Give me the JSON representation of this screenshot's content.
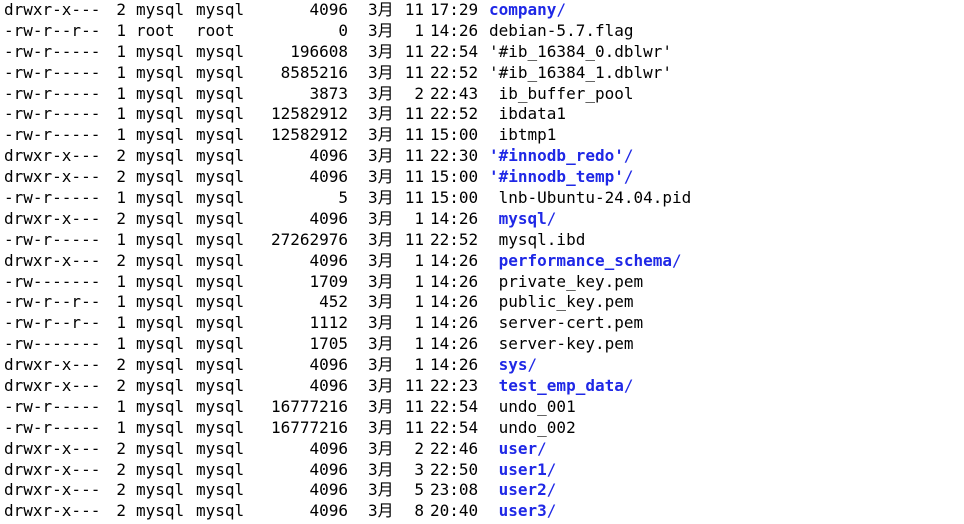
{
  "colors": {
    "background": "#ffffff",
    "text": "#000000",
    "directory": "#1f28e6"
  },
  "listing": [
    {
      "perms": "drwxr-x---",
      "links": "2",
      "owner": "mysql",
      "group": "mysql",
      "size": "4096",
      "month": "3月",
      "day": "11",
      "time": "17:29",
      "name": "company",
      "suffix": "/",
      "is_dir": true
    },
    {
      "perms": "-rw-r--r--",
      "links": "1",
      "owner": "root",
      "group": "root",
      "size": "0",
      "month": "3月",
      "day": "1",
      "time": "14:26",
      "name": "debian-5.7.flag",
      "suffix": "",
      "is_dir": false
    },
    {
      "perms": "-rw-r-----",
      "links": "1",
      "owner": "mysql",
      "group": "mysql",
      "size": "196608",
      "month": "3月",
      "day": "11",
      "time": "22:54",
      "name": "'#ib_16384_0.dblwr'",
      "suffix": "",
      "is_dir": false
    },
    {
      "perms": "-rw-r-----",
      "links": "1",
      "owner": "mysql",
      "group": "mysql",
      "size": "8585216",
      "month": "3月",
      "day": "11",
      "time": "22:52",
      "name": "'#ib_16384_1.dblwr'",
      "suffix": "",
      "is_dir": false
    },
    {
      "perms": "-rw-r-----",
      "links": "1",
      "owner": "mysql",
      "group": "mysql",
      "size": "3873",
      "month": "3月",
      "day": "2",
      "time": "22:43",
      "name": " ib_buffer_pool",
      "suffix": "",
      "is_dir": false
    },
    {
      "perms": "-rw-r-----",
      "links": "1",
      "owner": "mysql",
      "group": "mysql",
      "size": "12582912",
      "month": "3月",
      "day": "11",
      "time": "22:52",
      "name": " ibdata1",
      "suffix": "",
      "is_dir": false
    },
    {
      "perms": "-rw-r-----",
      "links": "1",
      "owner": "mysql",
      "group": "mysql",
      "size": "12582912",
      "month": "3月",
      "day": "11",
      "time": "15:00",
      "name": " ibtmp1",
      "suffix": "",
      "is_dir": false
    },
    {
      "perms": "drwxr-x---",
      "links": "2",
      "owner": "mysql",
      "group": "mysql",
      "size": "4096",
      "month": "3月",
      "day": "11",
      "time": "22:30",
      "name": "'#innodb_redo'",
      "suffix": "/",
      "is_dir": true
    },
    {
      "perms": "drwxr-x---",
      "links": "2",
      "owner": "mysql",
      "group": "mysql",
      "size": "4096",
      "month": "3月",
      "day": "11",
      "time": "15:00",
      "name": "'#innodb_temp'",
      "suffix": "/",
      "is_dir": true
    },
    {
      "perms": "-rw-r-----",
      "links": "1",
      "owner": "mysql",
      "group": "mysql",
      "size": "5",
      "month": "3月",
      "day": "11",
      "time": "15:00",
      "name": " lnb-Ubuntu-24.04.pid",
      "suffix": "",
      "is_dir": false
    },
    {
      "perms": "drwxr-x---",
      "links": "2",
      "owner": "mysql",
      "group": "mysql",
      "size": "4096",
      "month": "3月",
      "day": "1",
      "time": "14:26",
      "name": " mysql",
      "suffix": "/",
      "is_dir": true
    },
    {
      "perms": "-rw-r-----",
      "links": "1",
      "owner": "mysql",
      "group": "mysql",
      "size": "27262976",
      "month": "3月",
      "day": "11",
      "time": "22:52",
      "name": " mysql.ibd",
      "suffix": "",
      "is_dir": false
    },
    {
      "perms": "drwxr-x---",
      "links": "2",
      "owner": "mysql",
      "group": "mysql",
      "size": "4096",
      "month": "3月",
      "day": "1",
      "time": "14:26",
      "name": " performance_schema",
      "suffix": "/",
      "is_dir": true
    },
    {
      "perms": "-rw-------",
      "links": "1",
      "owner": "mysql",
      "group": "mysql",
      "size": "1709",
      "month": "3月",
      "day": "1",
      "time": "14:26",
      "name": " private_key.pem",
      "suffix": "",
      "is_dir": false
    },
    {
      "perms": "-rw-r--r--",
      "links": "1",
      "owner": "mysql",
      "group": "mysql",
      "size": "452",
      "month": "3月",
      "day": "1",
      "time": "14:26",
      "name": " public_key.pem",
      "suffix": "",
      "is_dir": false
    },
    {
      "perms": "-rw-r--r--",
      "links": "1",
      "owner": "mysql",
      "group": "mysql",
      "size": "1112",
      "month": "3月",
      "day": "1",
      "time": "14:26",
      "name": " server-cert.pem",
      "suffix": "",
      "is_dir": false
    },
    {
      "perms": "-rw-------",
      "links": "1",
      "owner": "mysql",
      "group": "mysql",
      "size": "1705",
      "month": "3月",
      "day": "1",
      "time": "14:26",
      "name": " server-key.pem",
      "suffix": "",
      "is_dir": false
    },
    {
      "perms": "drwxr-x---",
      "links": "2",
      "owner": "mysql",
      "group": "mysql",
      "size": "4096",
      "month": "3月",
      "day": "1",
      "time": "14:26",
      "name": " sys",
      "suffix": "/",
      "is_dir": true
    },
    {
      "perms": "drwxr-x---",
      "links": "2",
      "owner": "mysql",
      "group": "mysql",
      "size": "4096",
      "month": "3月",
      "day": "11",
      "time": "22:23",
      "name": " test_emp_data",
      "suffix": "/",
      "is_dir": true
    },
    {
      "perms": "-rw-r-----",
      "links": "1",
      "owner": "mysql",
      "group": "mysql",
      "size": "16777216",
      "month": "3月",
      "day": "11",
      "time": "22:54",
      "name": " undo_001",
      "suffix": "",
      "is_dir": false
    },
    {
      "perms": "-rw-r-----",
      "links": "1",
      "owner": "mysql",
      "group": "mysql",
      "size": "16777216",
      "month": "3月",
      "day": "11",
      "time": "22:54",
      "name": " undo_002",
      "suffix": "",
      "is_dir": false
    },
    {
      "perms": "drwxr-x---",
      "links": "2",
      "owner": "mysql",
      "group": "mysql",
      "size": "4096",
      "month": "3月",
      "day": "2",
      "time": "22:46",
      "name": " user",
      "suffix": "/",
      "is_dir": true
    },
    {
      "perms": "drwxr-x---",
      "links": "2",
      "owner": "mysql",
      "group": "mysql",
      "size": "4096",
      "month": "3月",
      "day": "3",
      "time": "22:50",
      "name": " user1",
      "suffix": "/",
      "is_dir": true
    },
    {
      "perms": "drwxr-x---",
      "links": "2",
      "owner": "mysql",
      "group": "mysql",
      "size": "4096",
      "month": "3月",
      "day": "5",
      "time": "23:08",
      "name": " user2",
      "suffix": "/",
      "is_dir": true
    },
    {
      "perms": "drwxr-x---",
      "links": "2",
      "owner": "mysql",
      "group": "mysql",
      "size": "4096",
      "month": "3月",
      "day": "8",
      "time": "20:40",
      "name": " user3",
      "suffix": "/",
      "is_dir": true
    }
  ]
}
